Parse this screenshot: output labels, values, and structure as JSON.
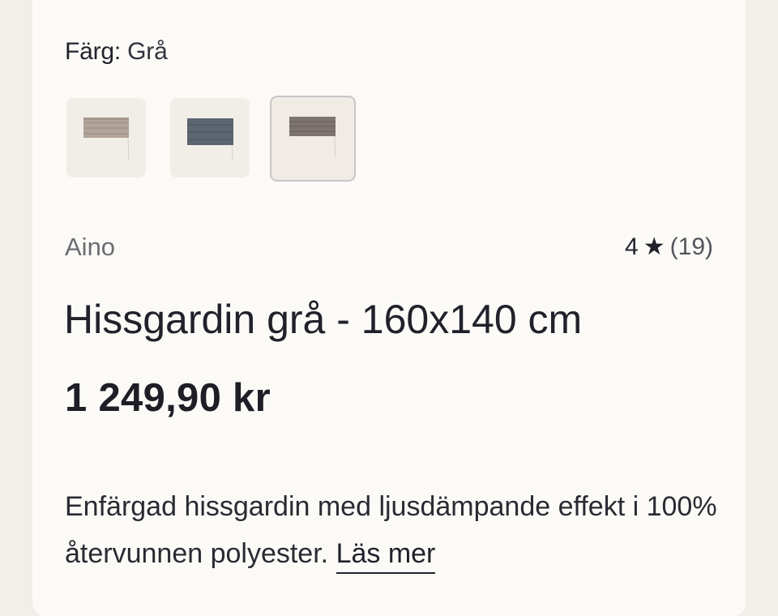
{
  "color_selector": {
    "label": "Färg:",
    "selected_value": "Grå",
    "swatches": [
      {
        "name": "beige",
        "fabric_color": "#b3a49a",
        "selected": false
      },
      {
        "name": "blue",
        "fabric_color": "#58606c",
        "selected": false
      },
      {
        "name": "grey",
        "fabric_color": "#7d7470",
        "selected": true
      }
    ]
  },
  "product": {
    "brand": "Aino",
    "rating_value": "4",
    "rating_star": "★",
    "rating_count": "(19)",
    "title": "Hissgardin grå - 160x140 cm",
    "price": "1 249,90 kr",
    "description": "Enfärgad hissgardin med ljusdämpande effekt i 100% återvunnen polyester.",
    "read_more_label": "Läs mer"
  },
  "colors": {
    "page_bg": "#f1efea",
    "card_bg": "#fbfaf6",
    "text": "#22212b",
    "muted_text": "#6d6b72"
  }
}
